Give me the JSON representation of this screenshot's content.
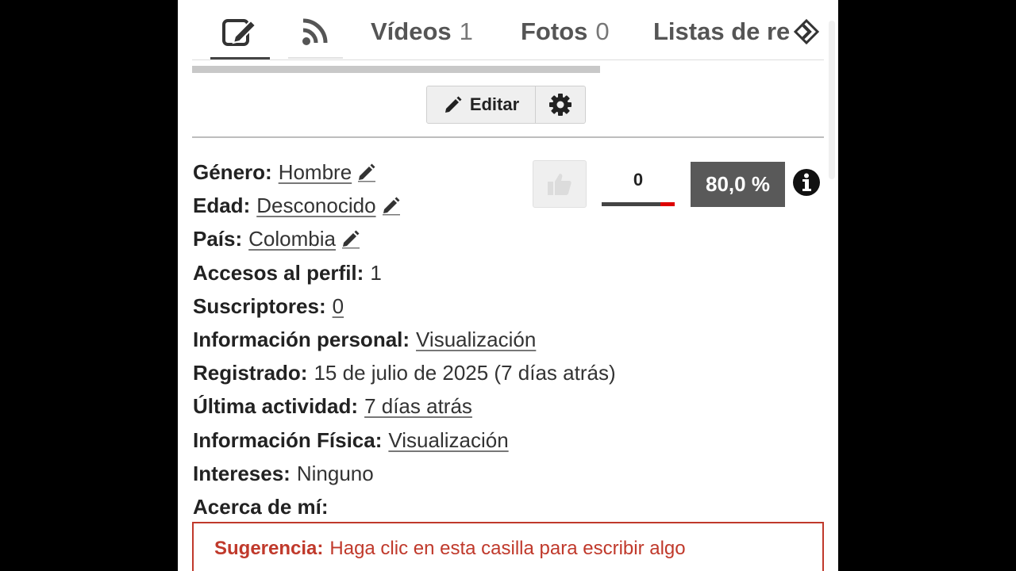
{
  "tabs": [
    {
      "name": "Vídeos",
      "count": "1"
    },
    {
      "name": "Fotos",
      "count": "0"
    },
    {
      "name": "Listas de re",
      "count": ""
    }
  ],
  "icons": {
    "tab_1": "edit-note-icon",
    "tab_2": "rss-feed-icon",
    "scroll": "chevron-right-icon",
    "edit": "pencil-icon",
    "settings": "gear-icon",
    "like": "thumbs-up-icon",
    "info": "info-icon"
  },
  "toolbar": {
    "edit_label": "Editar"
  },
  "profile": {
    "gender_label": "Género:",
    "gender_value": "Hombre",
    "age_label": "Edad:",
    "age_value": "Desconocido",
    "country_label": "País:",
    "country_value": "Colombia",
    "views_label": "Accesos al perfil:",
    "views_value": "1",
    "subscribers_label": "Suscriptores:",
    "subscribers_value": "0",
    "personal_label": "Información personal:",
    "personal_value": "Visualización",
    "registered_label": "Registrado:",
    "registered_value": "15 de julio de 2025 (7 días atrás)",
    "last_activity_label": "Última actividad:",
    "last_activity_value": "7 días atrás",
    "physical_label": "Información Física:",
    "physical_value": "Visualización",
    "interests_label": "Intereses:",
    "interests_value": "Ninguno",
    "about_label": "Acerca de mí:"
  },
  "rating": {
    "likes": "0",
    "percent": "80,0 %",
    "dislike_fraction": 0.2
  },
  "suggestion": {
    "label": "Sugerencia:",
    "text": "Haga clic en esta casilla para escribir algo"
  },
  "colors": {
    "accent_red": "#c0392b",
    "badge_bg": "#595959"
  }
}
